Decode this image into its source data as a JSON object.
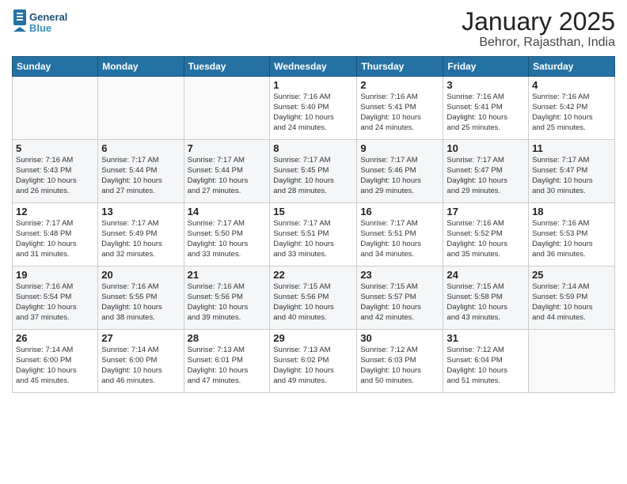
{
  "header": {
    "logo_line1": "General",
    "logo_line2": "Blue",
    "title": "January 2025",
    "subtitle": "Behror, Rajasthan, India"
  },
  "days_of_week": [
    "Sunday",
    "Monday",
    "Tuesday",
    "Wednesday",
    "Thursday",
    "Friday",
    "Saturday"
  ],
  "weeks": [
    [
      {
        "day": "",
        "info": ""
      },
      {
        "day": "",
        "info": ""
      },
      {
        "day": "",
        "info": ""
      },
      {
        "day": "1",
        "info": "Sunrise: 7:16 AM\nSunset: 5:40 PM\nDaylight: 10 hours\nand 24 minutes."
      },
      {
        "day": "2",
        "info": "Sunrise: 7:16 AM\nSunset: 5:41 PM\nDaylight: 10 hours\nand 24 minutes."
      },
      {
        "day": "3",
        "info": "Sunrise: 7:16 AM\nSunset: 5:41 PM\nDaylight: 10 hours\nand 25 minutes."
      },
      {
        "day": "4",
        "info": "Sunrise: 7:16 AM\nSunset: 5:42 PM\nDaylight: 10 hours\nand 25 minutes."
      }
    ],
    [
      {
        "day": "5",
        "info": "Sunrise: 7:16 AM\nSunset: 5:43 PM\nDaylight: 10 hours\nand 26 minutes."
      },
      {
        "day": "6",
        "info": "Sunrise: 7:17 AM\nSunset: 5:44 PM\nDaylight: 10 hours\nand 27 minutes."
      },
      {
        "day": "7",
        "info": "Sunrise: 7:17 AM\nSunset: 5:44 PM\nDaylight: 10 hours\nand 27 minutes."
      },
      {
        "day": "8",
        "info": "Sunrise: 7:17 AM\nSunset: 5:45 PM\nDaylight: 10 hours\nand 28 minutes."
      },
      {
        "day": "9",
        "info": "Sunrise: 7:17 AM\nSunset: 5:46 PM\nDaylight: 10 hours\nand 29 minutes."
      },
      {
        "day": "10",
        "info": "Sunrise: 7:17 AM\nSunset: 5:47 PM\nDaylight: 10 hours\nand 29 minutes."
      },
      {
        "day": "11",
        "info": "Sunrise: 7:17 AM\nSunset: 5:47 PM\nDaylight: 10 hours\nand 30 minutes."
      }
    ],
    [
      {
        "day": "12",
        "info": "Sunrise: 7:17 AM\nSunset: 5:48 PM\nDaylight: 10 hours\nand 31 minutes."
      },
      {
        "day": "13",
        "info": "Sunrise: 7:17 AM\nSunset: 5:49 PM\nDaylight: 10 hours\nand 32 minutes."
      },
      {
        "day": "14",
        "info": "Sunrise: 7:17 AM\nSunset: 5:50 PM\nDaylight: 10 hours\nand 33 minutes."
      },
      {
        "day": "15",
        "info": "Sunrise: 7:17 AM\nSunset: 5:51 PM\nDaylight: 10 hours\nand 33 minutes."
      },
      {
        "day": "16",
        "info": "Sunrise: 7:17 AM\nSunset: 5:51 PM\nDaylight: 10 hours\nand 34 minutes."
      },
      {
        "day": "17",
        "info": "Sunrise: 7:16 AM\nSunset: 5:52 PM\nDaylight: 10 hours\nand 35 minutes."
      },
      {
        "day": "18",
        "info": "Sunrise: 7:16 AM\nSunset: 5:53 PM\nDaylight: 10 hours\nand 36 minutes."
      }
    ],
    [
      {
        "day": "19",
        "info": "Sunrise: 7:16 AM\nSunset: 5:54 PM\nDaylight: 10 hours\nand 37 minutes."
      },
      {
        "day": "20",
        "info": "Sunrise: 7:16 AM\nSunset: 5:55 PM\nDaylight: 10 hours\nand 38 minutes."
      },
      {
        "day": "21",
        "info": "Sunrise: 7:16 AM\nSunset: 5:56 PM\nDaylight: 10 hours\nand 39 minutes."
      },
      {
        "day": "22",
        "info": "Sunrise: 7:15 AM\nSunset: 5:56 PM\nDaylight: 10 hours\nand 40 minutes."
      },
      {
        "day": "23",
        "info": "Sunrise: 7:15 AM\nSunset: 5:57 PM\nDaylight: 10 hours\nand 42 minutes."
      },
      {
        "day": "24",
        "info": "Sunrise: 7:15 AM\nSunset: 5:58 PM\nDaylight: 10 hours\nand 43 minutes."
      },
      {
        "day": "25",
        "info": "Sunrise: 7:14 AM\nSunset: 5:59 PM\nDaylight: 10 hours\nand 44 minutes."
      }
    ],
    [
      {
        "day": "26",
        "info": "Sunrise: 7:14 AM\nSunset: 6:00 PM\nDaylight: 10 hours\nand 45 minutes."
      },
      {
        "day": "27",
        "info": "Sunrise: 7:14 AM\nSunset: 6:00 PM\nDaylight: 10 hours\nand 46 minutes."
      },
      {
        "day": "28",
        "info": "Sunrise: 7:13 AM\nSunset: 6:01 PM\nDaylight: 10 hours\nand 47 minutes."
      },
      {
        "day": "29",
        "info": "Sunrise: 7:13 AM\nSunset: 6:02 PM\nDaylight: 10 hours\nand 49 minutes."
      },
      {
        "day": "30",
        "info": "Sunrise: 7:12 AM\nSunset: 6:03 PM\nDaylight: 10 hours\nand 50 minutes."
      },
      {
        "day": "31",
        "info": "Sunrise: 7:12 AM\nSunset: 6:04 PM\nDaylight: 10 hours\nand 51 minutes."
      },
      {
        "day": "",
        "info": ""
      }
    ]
  ]
}
